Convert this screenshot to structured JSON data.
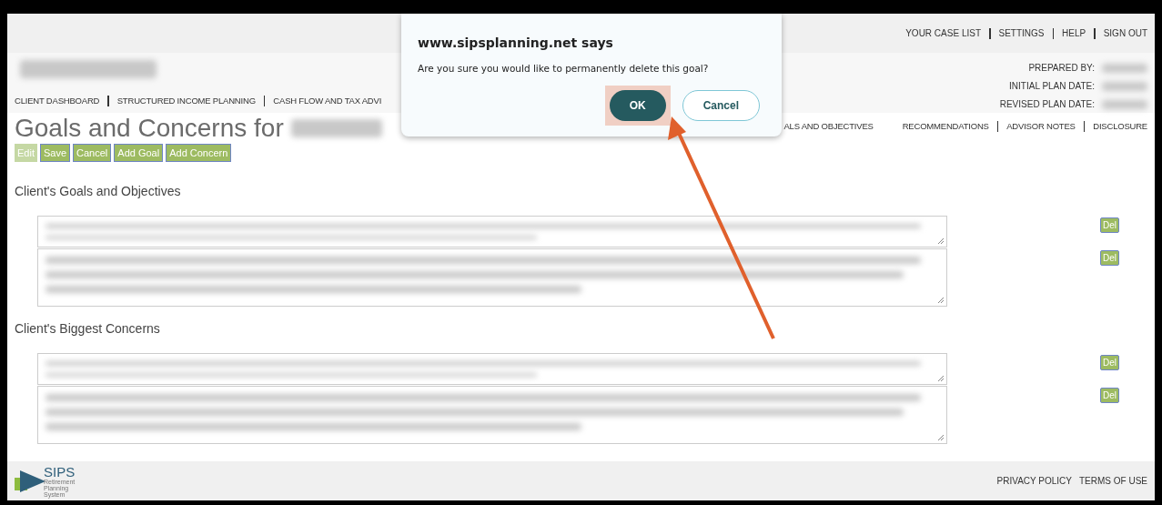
{
  "top_links": [
    "YOUR CASE LIST",
    "SETTINGS",
    "HELP",
    "SIGN OUT"
  ],
  "client_name": {
    "redacted": true
  },
  "plan_info": [
    {
      "label": "PREPARED BY:",
      "redacted": true
    },
    {
      "label": "INITIAL PLAN DATE:",
      "redacted": true
    },
    {
      "label": "REVISED PLAN DATE:",
      "redacted": true
    }
  ],
  "nav_left": [
    "CLIENT DASHBOARD",
    "STRUCTURED INCOME PLANNING",
    "CASH FLOW AND TAX ADVI"
  ],
  "nav_right": [
    "ALS AND OBJECTIVES",
    "RECOMMENDATIONS",
    "ADVISOR NOTES",
    "DISCLOSURE"
  ],
  "title": {
    "text": "Goals and Concerns for",
    "name_redacted": true
  },
  "toolbar": [
    {
      "label": "Edit",
      "disabled": true
    },
    {
      "label": "Save",
      "disabled": false
    },
    {
      "label": "Cancel",
      "disabled": false
    },
    {
      "label": "Add Goal",
      "disabled": false
    },
    {
      "label": "Add Concern",
      "disabled": false
    }
  ],
  "sections": [
    {
      "heading": "Client's Goals and Objectives",
      "items": [
        {
          "kind": "short",
          "redacted": true,
          "action": "Del"
        },
        {
          "kind": "tall",
          "redacted": true,
          "action": "Del"
        }
      ]
    },
    {
      "heading": "Client's Biggest Concerns",
      "items": [
        {
          "kind": "short",
          "redacted": true,
          "action": "Del"
        },
        {
          "kind": "tall",
          "redacted": true,
          "action": "Del"
        }
      ]
    }
  ],
  "footer": {
    "logo_text": "SIPS",
    "logo_subtitle": "Retirement Planning System",
    "links": [
      "PRIVACY POLICY",
      "TERMS OF USE"
    ]
  },
  "dialog": {
    "title": "www.sipsplanning.net says",
    "message": "Are you sure you would like to permanently delete this goal?",
    "buttons": [
      {
        "label": "OK",
        "kind": "primary",
        "highlighted": true
      },
      {
        "label": "Cancel",
        "kind": "secondary",
        "highlighted": false
      }
    ]
  },
  "annotation": {
    "kind": "arrow"
  }
}
